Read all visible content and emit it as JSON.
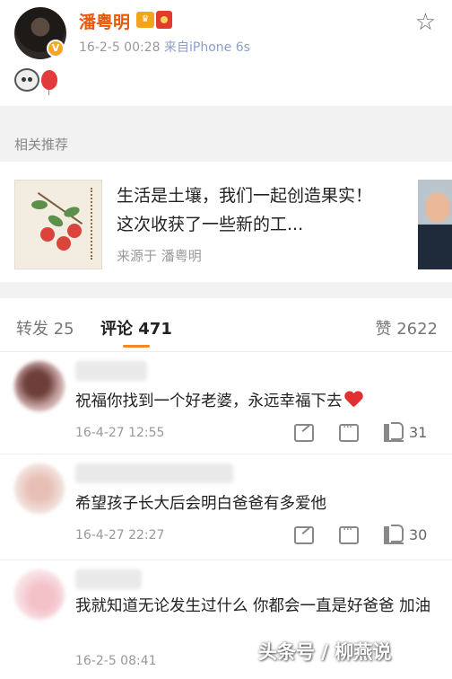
{
  "post": {
    "author": "潘粤明",
    "vip_badge": "V",
    "timestamp": "16-2-5 00:28",
    "source": "来自iPhone 6s",
    "star_icon": "star-outline-icon",
    "emoji": [
      "cow-icon",
      "balloon-icon"
    ]
  },
  "recommend": {
    "header": "相关推荐",
    "title": "生活是土壤，我们一起创造果实！这次收获了一些新的工...",
    "source": "来源于 潘粤明"
  },
  "tabs": {
    "repost": "转发 25",
    "comments": "评论 471",
    "likes": "赞 2622",
    "active_color": "#f08a24"
  },
  "comments": [
    {
      "text": "祝福你找到一个好老婆，永远幸福下去",
      "time": "16-4-27 12:55",
      "likes": "31"
    },
    {
      "text": "希望孩子长大后会明白爸爸有多爱他",
      "time": "16-4-27 22:27",
      "likes": "30"
    },
    {
      "text": "我就知道无论发生过什么 你都会一直是好爸爸 加油",
      "time": "16-2-5 08:41",
      "likes": ""
    }
  ],
  "watermark": "头条号 / 柳燕说"
}
